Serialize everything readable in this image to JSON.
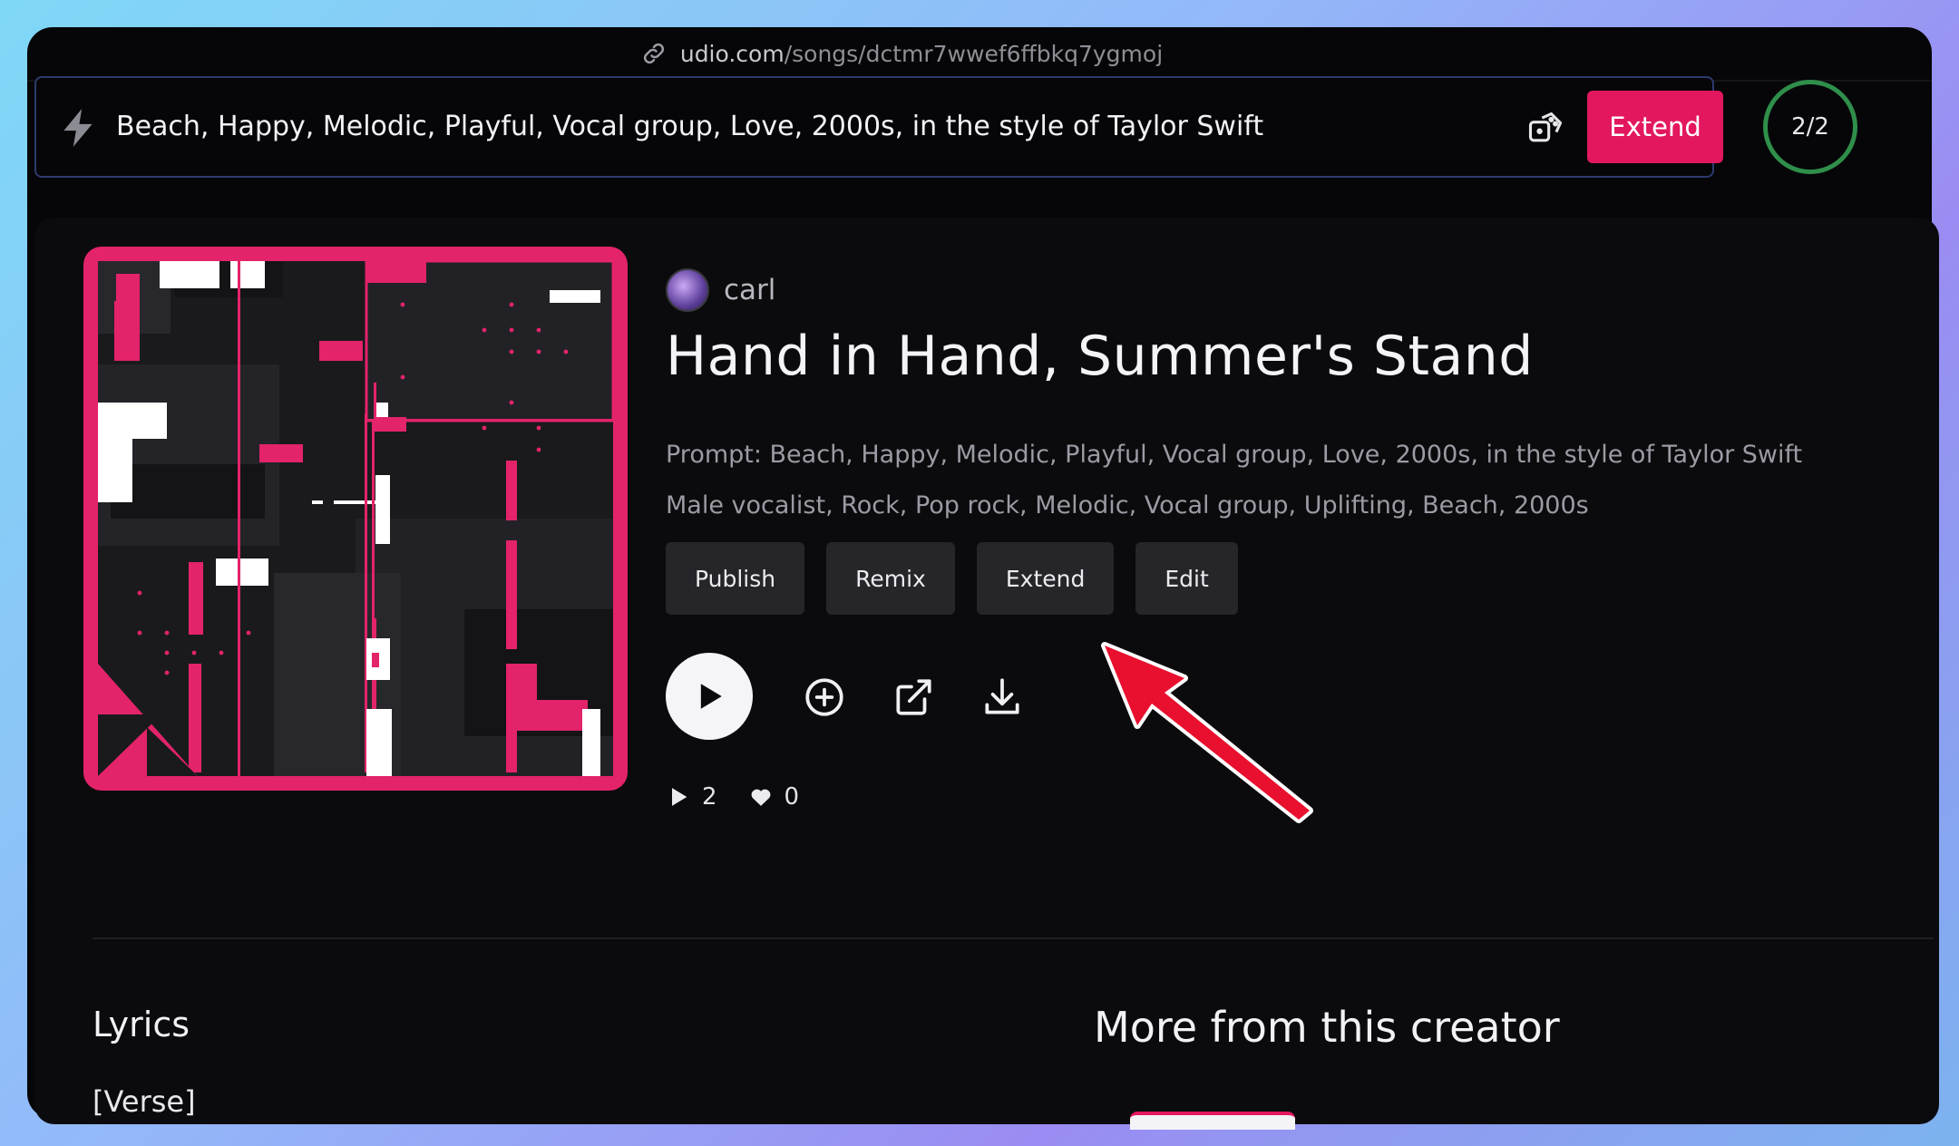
{
  "browser": {
    "url_host": "udio.com",
    "url_path": "/songs/dctmr7wwef6ffbkq7ygmoj"
  },
  "prompt_bar": {
    "text": "Beach, Happy, Melodic, Playful, Vocal group, Love, 2000s, in the style of Taylor Swift",
    "extend_label": "Extend",
    "counter": "2/2"
  },
  "song": {
    "creator": "carl",
    "title": "Hand in Hand, Summer's Stand",
    "prompt_line": "Prompt: Beach, Happy, Melodic, Playful, Vocal group, Love, 2000s, in the style of Taylor Swift",
    "tags_line": "Male vocalist, Rock, Pop rock, Melodic, Vocal group, Uplifting, Beach, 2000s",
    "actions": [
      "Publish",
      "Remix",
      "Extend",
      "Edit"
    ],
    "plays": "2",
    "likes": "0"
  },
  "icons": [
    "link-icon",
    "bolt-icon",
    "dice-icon",
    "play-icon",
    "add-icon",
    "share-icon",
    "download-icon",
    "heart-icon"
  ],
  "sections": {
    "lyrics_heading": "Lyrics",
    "lyrics_first_line": "[Verse]",
    "more_heading": "More from this creator"
  },
  "colors": {
    "accent": "#e3175f",
    "counter_ring": "#2f8f4a",
    "annotation_arrow": "#e8102e"
  }
}
